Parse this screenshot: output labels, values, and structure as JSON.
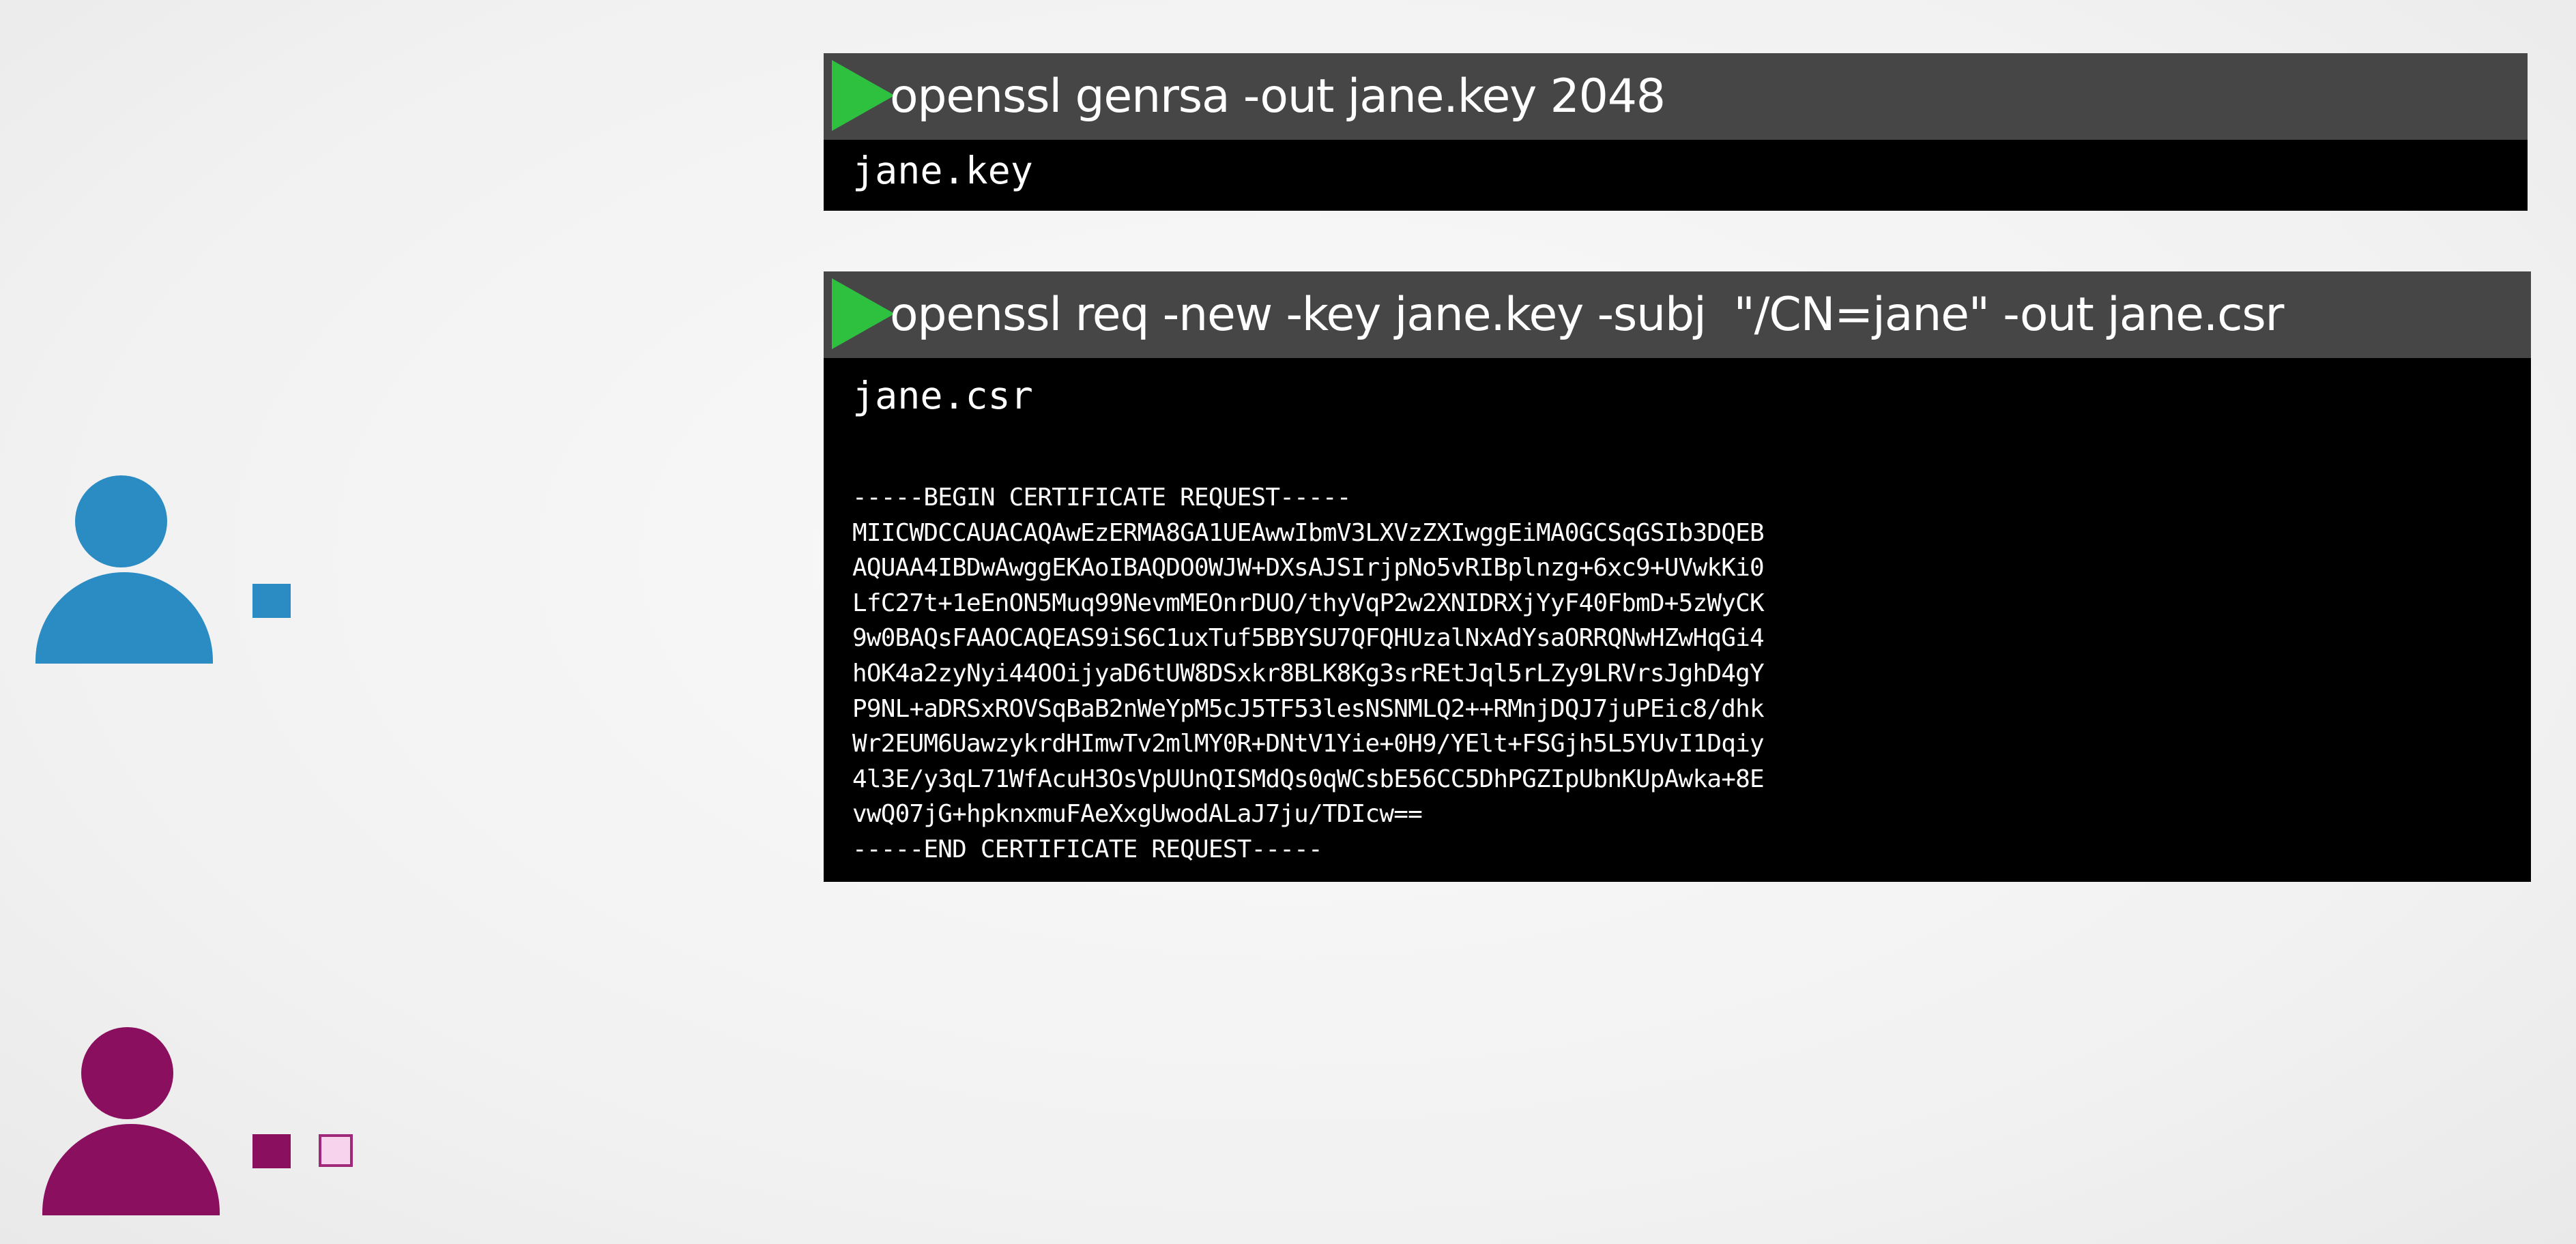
{
  "colors": {
    "user_1": "#2b8cc4",
    "user_2": "#8a0f5e",
    "csr_fill": "#f8d3ee",
    "csr_border": "#a0287a",
    "play_icon": "#2ec13f",
    "terminal_bg": "#000000",
    "command_bar_bg": "#464646"
  },
  "icons": {
    "user_1": "user-icon",
    "user_2": "user-icon",
    "play": "play-triangle-icon"
  },
  "terminals": [
    {
      "command": "openssl genrsa -out jane.key 2048",
      "output_file": "jane.key"
    },
    {
      "command": "openssl req -new -key jane.key -subj  \"/CN=jane\" -out jane.csr",
      "output_file": "jane.csr",
      "csr_lines": [
        "-----BEGIN CERTIFICATE REQUEST-----",
        "MIICWDCCAUACAQAwEzERMA8GA1UEAwwIbmV3LXVzZXIwggEiMA0GCSqGSIb3DQEB",
        "AQUAA4IBDwAwggEKAoIBAQDO0WJW+DXsAJSIrjpNo5vRIBplnzg+6xc9+UVwkKi0",
        "LfC27t+1eEnON5Muq99NevmMEOnrDUO/thyVqP2w2XNIDRXjYyF40FbmD+5zWyCK",
        "9w0BAQsFAAOCAQEAS9iS6C1uxTuf5BBYSU7QFQHUzalNxAdYsaORRQNwHZwHqGi4",
        "hOK4a2zyNyi44OOijyaD6tUW8DSxkr8BLK8Kg3srREtJql5rLZy9LRVrsJghD4gY",
        "P9NL+aDRSxROVSqBaB2nWeYpM5cJ5TF53lesNSNMLQ2++RMnjDQJ7juPEic8/dhk",
        "Wr2EUM6UawzykrdHImwTv2mlMY0R+DNtV1Yie+0H9/YElt+FSGjh5L5YUvI1Dqiy",
        "4l3E/y3qL71WfAcuH3OsVpUUnQISMdQs0qWCsbE56CC5DhPGZIpUbnKUpAwka+8E",
        "vwQ07jG+hpknxmuFAeXxgUwodALaJ7ju/TDIcw==",
        "-----END CERTIFICATE REQUEST-----"
      ]
    }
  ]
}
